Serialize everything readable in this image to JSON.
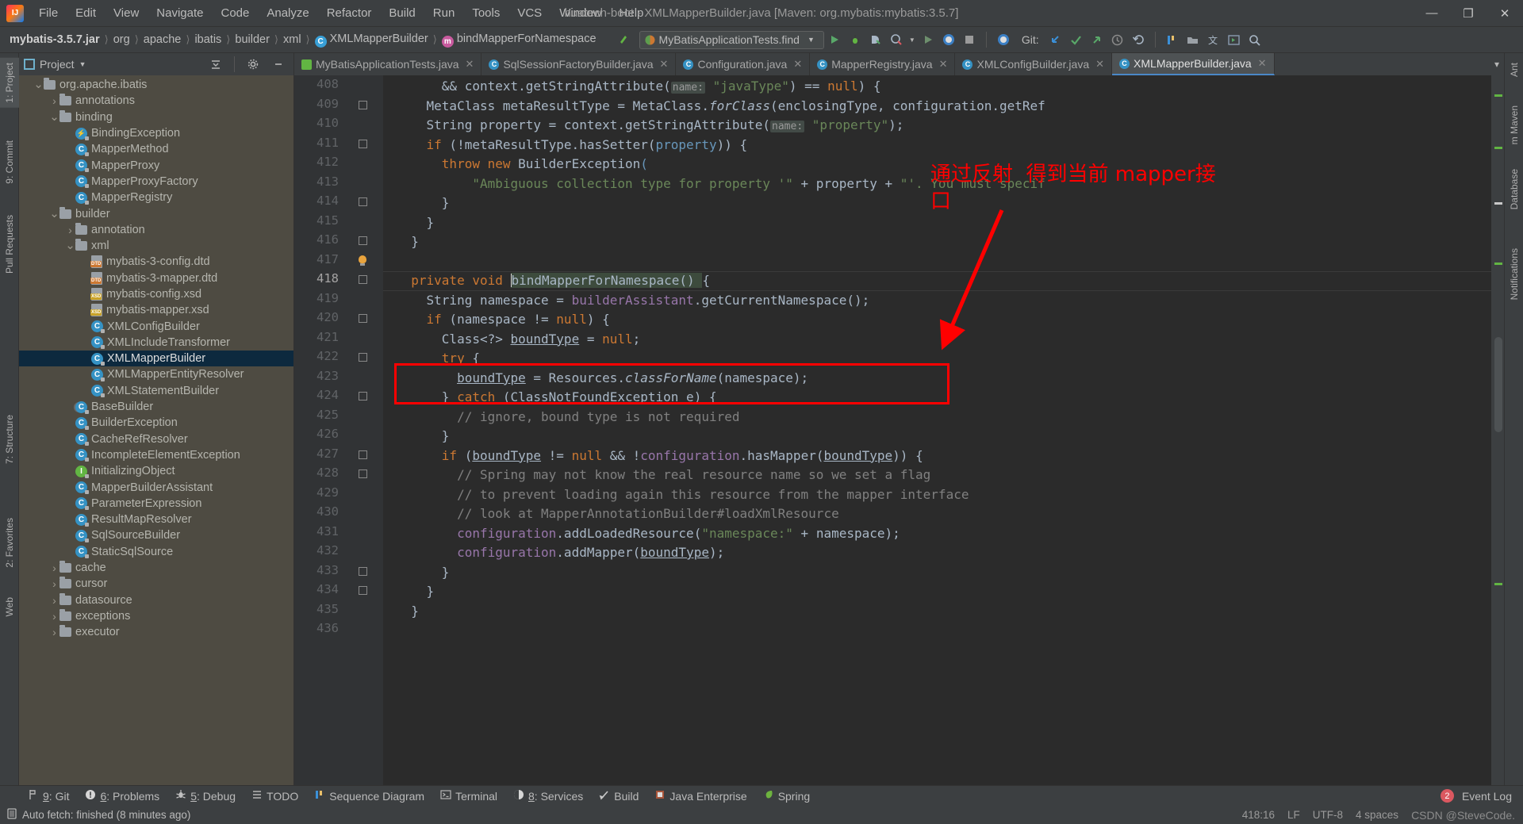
{
  "window": {
    "title": "huatech-boot - XMLMapperBuilder.java [Maven: org.mybatis:mybatis:3.5.7]",
    "minimize": "—",
    "maximize": "❐",
    "close": "✕"
  },
  "menu": [
    "File",
    "Edit",
    "View",
    "Navigate",
    "Code",
    "Analyze",
    "Refactor",
    "Build",
    "Run",
    "Tools",
    "VCS",
    "Window",
    "Help"
  ],
  "breadcrumbs": [
    {
      "label": "mybatis-3.5.7.jar",
      "bold": true,
      "icon": ""
    },
    {
      "label": "org",
      "bold": false,
      "icon": ""
    },
    {
      "label": "apache",
      "bold": false,
      "icon": ""
    },
    {
      "label": "ibatis",
      "bold": false,
      "icon": ""
    },
    {
      "label": "builder",
      "bold": false,
      "icon": ""
    },
    {
      "label": "xml",
      "bold": false,
      "icon": ""
    },
    {
      "label": "XMLMapperBuilder",
      "bold": false,
      "icon": "class-icon"
    },
    {
      "label": "bindMapperForNamespace",
      "bold": false,
      "icon": "method-icon"
    }
  ],
  "toolbar": {
    "run_config": "MyBatisApplicationTests.find",
    "git_label": "Git:",
    "icons": [
      "back-arrow-icon",
      "run-icon",
      "debug-icon",
      "coverage-icon",
      "profile-icon",
      "rerun-icon",
      "stop-icon",
      "inspect-icon",
      "update-project-icon",
      "commit-icon",
      "push-icon",
      "history-icon",
      "rollback-icon",
      "structure-icon",
      "project-files-icon",
      "translate-icon",
      "preview-icon",
      "search-everywhere-icon"
    ]
  },
  "left_rail": [
    {
      "label": "1: Project",
      "selected": true
    },
    {
      "label": "9: Commit",
      "selected": false
    },
    {
      "label": "Pull Requests",
      "selected": false
    },
    {
      "label": "7: Structure",
      "selected": false
    },
    {
      "label": "2: Favorites",
      "selected": false
    },
    {
      "label": "Web",
      "selected": false
    }
  ],
  "right_rail": [
    "Ant",
    "m Maven",
    "Database",
    "Notifications"
  ],
  "project_panel": {
    "title": "Project",
    "icons": [
      "collapse-all-icon",
      "gear-icon",
      "hide-icon"
    ],
    "tree": [
      {
        "label": "org.apache.ibatis",
        "type": "folder",
        "indent": 2,
        "arrow": "down"
      },
      {
        "label": "annotations",
        "type": "folder",
        "indent": 3,
        "arrow": "right"
      },
      {
        "label": "binding",
        "type": "folder",
        "indent": 3,
        "arrow": "down"
      },
      {
        "label": "BindingException",
        "type": "exception",
        "indent": 4,
        "arrow": ""
      },
      {
        "label": "MapperMethod",
        "type": "class",
        "indent": 4,
        "arrow": ""
      },
      {
        "label": "MapperProxy",
        "type": "class",
        "indent": 4,
        "arrow": ""
      },
      {
        "label": "MapperProxyFactory",
        "type": "class",
        "indent": 4,
        "arrow": ""
      },
      {
        "label": "MapperRegistry",
        "type": "class",
        "indent": 4,
        "arrow": ""
      },
      {
        "label": "builder",
        "type": "folder",
        "indent": 3,
        "arrow": "down"
      },
      {
        "label": "annotation",
        "type": "folder",
        "indent": 4,
        "arrow": "right"
      },
      {
        "label": "xml",
        "type": "folder",
        "indent": 4,
        "arrow": "down"
      },
      {
        "label": "mybatis-3-config.dtd",
        "type": "dtd",
        "indent": 5,
        "arrow": ""
      },
      {
        "label": "mybatis-3-mapper.dtd",
        "type": "dtd",
        "indent": 5,
        "arrow": ""
      },
      {
        "label": "mybatis-config.xsd",
        "type": "xsd",
        "indent": 5,
        "arrow": ""
      },
      {
        "label": "mybatis-mapper.xsd",
        "type": "xsd",
        "indent": 5,
        "arrow": ""
      },
      {
        "label": "XMLConfigBuilder",
        "type": "class",
        "indent": 5,
        "arrow": ""
      },
      {
        "label": "XMLIncludeTransformer",
        "type": "class",
        "indent": 5,
        "arrow": ""
      },
      {
        "label": "XMLMapperBuilder",
        "type": "class",
        "indent": 5,
        "arrow": "",
        "selected": true
      },
      {
        "label": "XMLMapperEntityResolver",
        "type": "class",
        "indent": 5,
        "arrow": ""
      },
      {
        "label": "XMLStatementBuilder",
        "type": "class",
        "indent": 5,
        "arrow": ""
      },
      {
        "label": "BaseBuilder",
        "type": "abstract",
        "indent": 4,
        "arrow": ""
      },
      {
        "label": "BuilderException",
        "type": "class",
        "indent": 4,
        "arrow": ""
      },
      {
        "label": "CacheRefResolver",
        "type": "class",
        "indent": 4,
        "arrow": ""
      },
      {
        "label": "IncompleteElementException",
        "type": "class",
        "indent": 4,
        "arrow": ""
      },
      {
        "label": "InitializingObject",
        "type": "interface",
        "indent": 4,
        "arrow": ""
      },
      {
        "label": "MapperBuilderAssistant",
        "type": "class",
        "indent": 4,
        "arrow": ""
      },
      {
        "label": "ParameterExpression",
        "type": "class",
        "indent": 4,
        "arrow": ""
      },
      {
        "label": "ResultMapResolver",
        "type": "class",
        "indent": 4,
        "arrow": ""
      },
      {
        "label": "SqlSourceBuilder",
        "type": "class",
        "indent": 4,
        "arrow": ""
      },
      {
        "label": "StaticSqlSource",
        "type": "class",
        "indent": 4,
        "arrow": ""
      },
      {
        "label": "cache",
        "type": "folder",
        "indent": 3,
        "arrow": "right"
      },
      {
        "label": "cursor",
        "type": "folder",
        "indent": 3,
        "arrow": "right"
      },
      {
        "label": "datasource",
        "type": "folder",
        "indent": 3,
        "arrow": "right"
      },
      {
        "label": "exceptions",
        "type": "folder",
        "indent": 3,
        "arrow": "right"
      },
      {
        "label": "executor",
        "type": "folder",
        "indent": 3,
        "arrow": "right"
      }
    ]
  },
  "editor_tabs": [
    {
      "label": "MyBatisApplicationTests.java",
      "icon": "test-class-icon",
      "active": false
    },
    {
      "label": "SqlSessionFactoryBuilder.java",
      "icon": "class-icon",
      "active": false
    },
    {
      "label": "Configuration.java",
      "icon": "class-icon",
      "active": false
    },
    {
      "label": "MapperRegistry.java",
      "icon": "class-icon",
      "active": false
    },
    {
      "label": "XMLConfigBuilder.java",
      "icon": "class-icon",
      "active": false
    },
    {
      "label": "XMLMapperBuilder.java",
      "icon": "class-icon",
      "active": true
    }
  ],
  "code": {
    "first_line": 408,
    "current_line": 418,
    "lines": [
      {
        "n": 408,
        "html": "      && context.getStringAttribute(<span class=\"param-hint\">name:</span> <span class=\"str\">\"javaType\"</span>) == <span class=\"kw\">null</span>) {"
      },
      {
        "n": 409,
        "html": "    MetaClass metaResultType = MetaClass.<span class=\"ital\">forClass</span>(enclosingType, configuration.getRef"
      },
      {
        "n": 410,
        "html": "    String property = context.getStringAttribute(<span class=\"param-hint\">name:</span> <span class=\"str\">\"property\"</span>);"
      },
      {
        "n": 411,
        "html": "    <span class=\"kw\">if</span> (!metaResultType.hasSetter(<span class=\"brace-b\">property</span>)) {"
      },
      {
        "n": 412,
        "html": "      <span class=\"kw\">throw new</span> BuilderException<span class=\"brace-b\">(</span>"
      },
      {
        "n": 413,
        "html": "          <span class=\"str\">\"Ambiguous collection type for property '\"</span> + property + <span class=\"str\">\"'. You must specif</span>"
      },
      {
        "n": 414,
        "html": "      }"
      },
      {
        "n": 415,
        "html": "    }"
      },
      {
        "n": 416,
        "html": "  }"
      },
      {
        "n": 417,
        "html": ""
      },
      {
        "n": 418,
        "html": "  <span class=\"kw\">private void </span><span class=\"mname-hl\"><span class=\"caret\"></span>bindMapperForNamespace() </span>{"
      },
      {
        "n": 419,
        "html": "    String namespace = <span class=\"fld\">builderAssistant</span>.getCurrentNamespace();"
      },
      {
        "n": 420,
        "html": "    <span class=\"kw\">if</span> (namespace != <span class=\"kw\">null</span>) {"
      },
      {
        "n": 421,
        "html": "      Class&lt;?&gt; <span class=\"undl\">boundType</span> = <span class=\"kw\">null</span>;"
      },
      {
        "n": 422,
        "html": "      <span class=\"kw\">try</span> {"
      },
      {
        "n": 423,
        "html": "        <span class=\"undl\">boundType</span> = Resources.<span class=\"ital\">classForName</span>(namespace);"
      },
      {
        "n": 424,
        "html": "      } <span class=\"kw\">catch</span> (ClassNotFoundException e) {"
      },
      {
        "n": 425,
        "html": "        <span class=\"cmt\">// ignore, bound type is not required</span>"
      },
      {
        "n": 426,
        "html": "      }"
      },
      {
        "n": 427,
        "html": "      <span class=\"kw\">if</span> (<span class=\"undl\">boundType</span> != <span class=\"kw\">null</span> &amp;&amp; !<span class=\"fld\">configuration</span>.hasMapper(<span class=\"undl\">boundType</span>)) {"
      },
      {
        "n": 428,
        "html": "        <span class=\"cmt\">// Spring may not know the real resource name so we set a flag</span>"
      },
      {
        "n": 429,
        "html": "        <span class=\"cmt\">// to prevent loading again this resource from the mapper interface</span>"
      },
      {
        "n": 430,
        "html": "        <span class=\"cmt\">// look at MapperAnnotationBuilder#loadXmlResource</span>"
      },
      {
        "n": 431,
        "html": "        <span class=\"fld\">configuration</span>.addLoadedResource(<span class=\"str\">\"namespace:\"</span> + namespace);"
      },
      {
        "n": 432,
        "html": "        <span class=\"fld\">configuration</span>.addMapper(<span class=\"undl\">boundType</span>);"
      },
      {
        "n": 433,
        "html": "      }"
      },
      {
        "n": 434,
        "html": "    }"
      },
      {
        "n": 435,
        "html": "  }"
      },
      {
        "n": 436,
        "html": ""
      }
    ]
  },
  "annotation": {
    "text_line1": "通过反射  得到当前 mapper接",
    "text_line2": "口",
    "color": "#ff0000",
    "highlight_box_label": "boundType = Resources.classForName(namespace);"
  },
  "bottom_tools": [
    {
      "key": "9",
      "label": ": Git",
      "icon": "git-icon"
    },
    {
      "key": "6",
      "label": ": Problems",
      "icon": "problems-icon"
    },
    {
      "key": "5",
      "label": ": Debug",
      "icon": "debug-icon"
    },
    {
      "key": "",
      "label": "TODO",
      "icon": "todo-icon"
    },
    {
      "key": "",
      "label": "Sequence Diagram",
      "icon": "sequence-diagram-icon"
    },
    {
      "key": "",
      "label": "Terminal",
      "icon": "terminal-icon"
    },
    {
      "key": "8",
      "label": ": Services",
      "icon": "services-icon"
    },
    {
      "key": "",
      "label": "Build",
      "icon": "build-icon"
    },
    {
      "key": "",
      "label": "Java Enterprise",
      "icon": "java-enterprise-icon"
    },
    {
      "key": "",
      "label": "Spring",
      "icon": "spring-icon"
    }
  ],
  "event_log": {
    "label": "Event Log",
    "count": "2"
  },
  "status": {
    "message": "Auto fetch: finished (8 minutes ago)",
    "caret_position": "418:16",
    "line_separator": "LF",
    "encoding": "UTF-8",
    "indent": "4 spaces",
    "watermark": "CSDN @SteveCode."
  }
}
